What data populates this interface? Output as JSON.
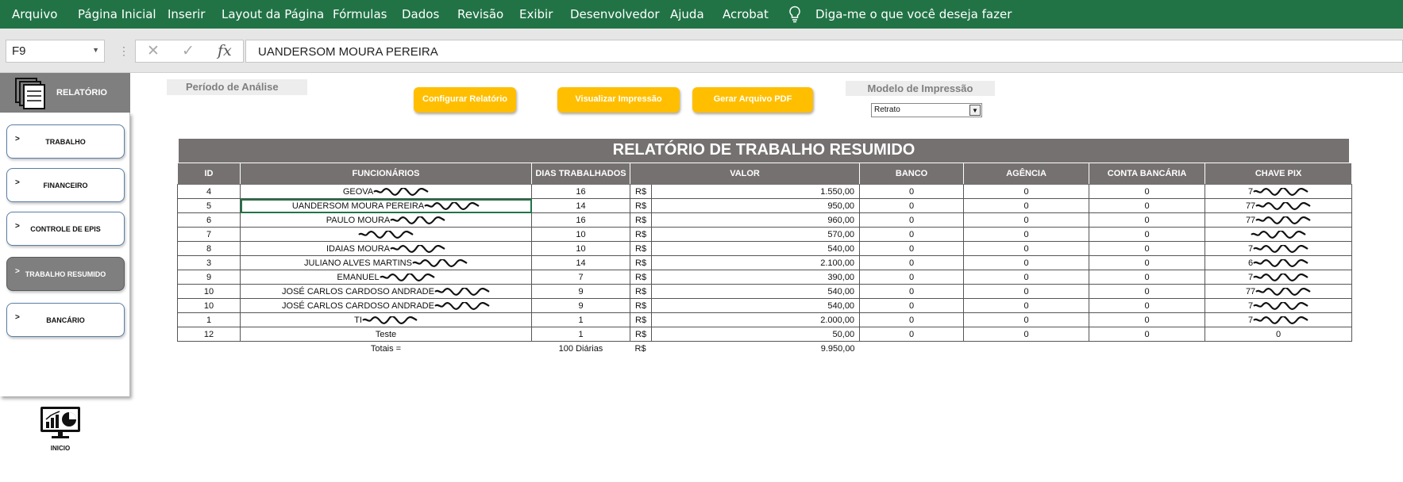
{
  "menu": {
    "items": [
      "Arquivo",
      "Página Inicial",
      "Inserir",
      "Layout da Página",
      "Fórmulas",
      "Dados",
      "Revisão",
      "Exibir",
      "Desenvolvedor",
      "Ajuda",
      "Acrobat"
    ],
    "tell_me": "Diga-me o que você deseja fazer"
  },
  "formula_bar": {
    "name_box": "F9",
    "value": "UANDERSOM MOURA PEREIRA"
  },
  "sidebar": {
    "title": "RELATÓRIO",
    "buttons": [
      {
        "label": "TRABALHO"
      },
      {
        "label": "FINANCEIRO"
      },
      {
        "label": "CONTROLE DE EPIS"
      },
      {
        "label": "TRABALHO RESUMIDO"
      },
      {
        "label": "BANCÁRIO"
      }
    ],
    "chevron": ">",
    "home_label": "INICIO"
  },
  "controls": {
    "periodo": "Período de Análise",
    "btn_config": "Configurar Relatório",
    "btn_preview": "Visualizar Impressão",
    "btn_pdf": "Gerar Arquivo PDF",
    "modelo": "Modelo de Impressão",
    "modelo_value": "Retrato"
  },
  "report": {
    "title": "RELATÓRIO DE TRABALHO RESUMIDO",
    "headers": [
      "ID",
      "FUNCIONÁRIOS",
      "DIAS TRABALHADOS",
      "VALOR",
      "",
      "BANCO",
      "AGÊNCIA",
      "CONTA BANCÁRIA",
      "CHAVE PIX"
    ],
    "rows": [
      {
        "id": "4",
        "nome": "GEOVA",
        "dias": "16",
        "cur": "R$",
        "valor": "1.550,00",
        "banco": "0",
        "agencia": "0",
        "conta": "0",
        "pix": "7"
      },
      {
        "id": "5",
        "nome": "UANDERSOM MOURA PEREIRA",
        "dias": "14",
        "cur": "R$",
        "valor": "950,00",
        "banco": "0",
        "agencia": "0",
        "conta": "0",
        "pix": "77"
      },
      {
        "id": "6",
        "nome": "PAULO MOURA",
        "dias": "16",
        "cur": "R$",
        "valor": "960,00",
        "banco": "0",
        "agencia": "0",
        "conta": "0",
        "pix": "77"
      },
      {
        "id": "7",
        "nome": "",
        "dias": "10",
        "cur": "R$",
        "valor": "570,00",
        "banco": "0",
        "agencia": "0",
        "conta": "0",
        "pix": ""
      },
      {
        "id": "8",
        "nome": "IDAIAS MOURA",
        "dias": "10",
        "cur": "R$",
        "valor": "540,00",
        "banco": "0",
        "agencia": "0",
        "conta": "0",
        "pix": "7"
      },
      {
        "id": "3",
        "nome": "JULIANO ALVES MARTINS",
        "dias": "14",
        "cur": "R$",
        "valor": "2.100,00",
        "banco": "0",
        "agencia": "0",
        "conta": "0",
        "pix": "6"
      },
      {
        "id": "9",
        "nome": "EMANUEL",
        "dias": "7",
        "cur": "R$",
        "valor": "390,00",
        "banco": "0",
        "agencia": "0",
        "conta": "0",
        "pix": "7"
      },
      {
        "id": "10",
        "nome": "JOSÉ CARLOS CARDOSO ANDRADE",
        "dias": "9",
        "cur": "R$",
        "valor": "540,00",
        "banco": "0",
        "agencia": "0",
        "conta": "0",
        "pix": "77"
      },
      {
        "id": "10",
        "nome": "JOSÉ CARLOS CARDOSO ANDRADE",
        "dias": "9",
        "cur": "R$",
        "valor": "540,00",
        "banco": "0",
        "agencia": "0",
        "conta": "0",
        "pix": "7"
      },
      {
        "id": "1",
        "nome": "TI",
        "dias": "1",
        "cur": "R$",
        "valor": "2.000,00",
        "banco": "0",
        "agencia": "0",
        "conta": "0",
        "pix": "7"
      },
      {
        "id": "12",
        "nome": "Teste",
        "dias": "1",
        "cur": "R$",
        "valor": "50,00",
        "banco": "0",
        "agencia": "0",
        "conta": "0",
        "pix": "0"
      }
    ],
    "totals": {
      "label": "Totais =",
      "dias": "100 Diárias",
      "cur": "R$",
      "valor": "9.950,00"
    }
  },
  "colors": {
    "ribbon": "#217346",
    "header_gray": "#767171",
    "button_gold": "#ffbf00"
  }
}
